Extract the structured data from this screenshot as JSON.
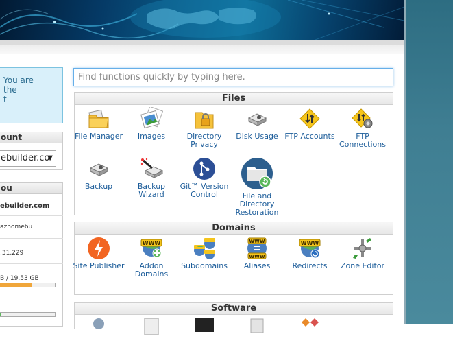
{
  "sidebar": {
    "notice_lines": [
      "You are",
      "the",
      "t"
    ],
    "account_header": "ount",
    "domain_select_value": "ebuilder.co",
    "info_header": "ou",
    "domain_value": "ebuilder.com",
    "user_value": "azhomebu",
    "ip_value": ".31.229",
    "disk_value": "B / 19.53 GB",
    "disk_usage_fraction": 0.62,
    "second_usage_fraction": 0.1
  },
  "search": {
    "placeholder": "Find functions quickly by typing here."
  },
  "files": {
    "title": "Files",
    "items": [
      {
        "label": "File Manager",
        "icon": "file-manager-icon"
      },
      {
        "label": "Images",
        "icon": "images-icon"
      },
      {
        "label": "Directory Privacy",
        "icon": "directory-privacy-icon"
      },
      {
        "label": "Disk Usage",
        "icon": "disk-usage-icon"
      },
      {
        "label": "FTP Accounts",
        "icon": "ftp-accounts-icon"
      },
      {
        "label": "FTP Connections",
        "icon": "ftp-connections-icon"
      },
      {
        "label": "Backup",
        "icon": "backup-icon"
      },
      {
        "label": "Backup Wizard",
        "icon": "backup-wizard-icon"
      },
      {
        "label": "Git™ Version Control",
        "icon": "git-icon"
      },
      {
        "label": "File and Directory Restoration",
        "icon": "restoration-icon"
      }
    ]
  },
  "domains": {
    "title": "Domains",
    "items": [
      {
        "label": "Site Publisher",
        "icon": "site-publisher-icon"
      },
      {
        "label": "Addon Domains",
        "icon": "addon-domains-icon"
      },
      {
        "label": "Subdomains",
        "icon": "subdomains-icon"
      },
      {
        "label": "Aliases",
        "icon": "aliases-icon"
      },
      {
        "label": "Redirects",
        "icon": "redirects-icon"
      },
      {
        "label": "Zone Editor",
        "icon": "zone-editor-icon"
      }
    ]
  },
  "software": {
    "title": "Software"
  }
}
